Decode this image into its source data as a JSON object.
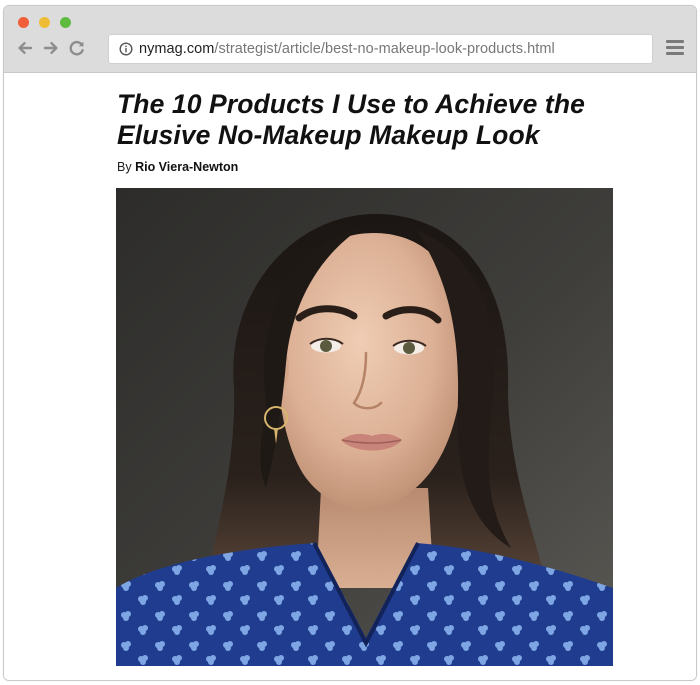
{
  "browser": {
    "url_host": "nymag.com",
    "url_path": "/strategist/article/best-no-makeup-look-products.html",
    "traffic_lights": [
      "close",
      "minimize",
      "zoom"
    ],
    "icons": {
      "back": "back-arrow-icon",
      "forward": "forward-arrow-icon",
      "reload": "reload-icon",
      "info": "info-icon",
      "menu": "hamburger-menu-icon"
    },
    "colors": {
      "close": "#f05e3a",
      "minimize": "#efbd35",
      "zoom": "#5fbb3f"
    }
  },
  "article": {
    "title": "The 10 Products I Use to Achieve the Elusive No-Makeup Makeup Look",
    "byline_prefix": "By ",
    "author": "Rio Viera-Newton"
  }
}
